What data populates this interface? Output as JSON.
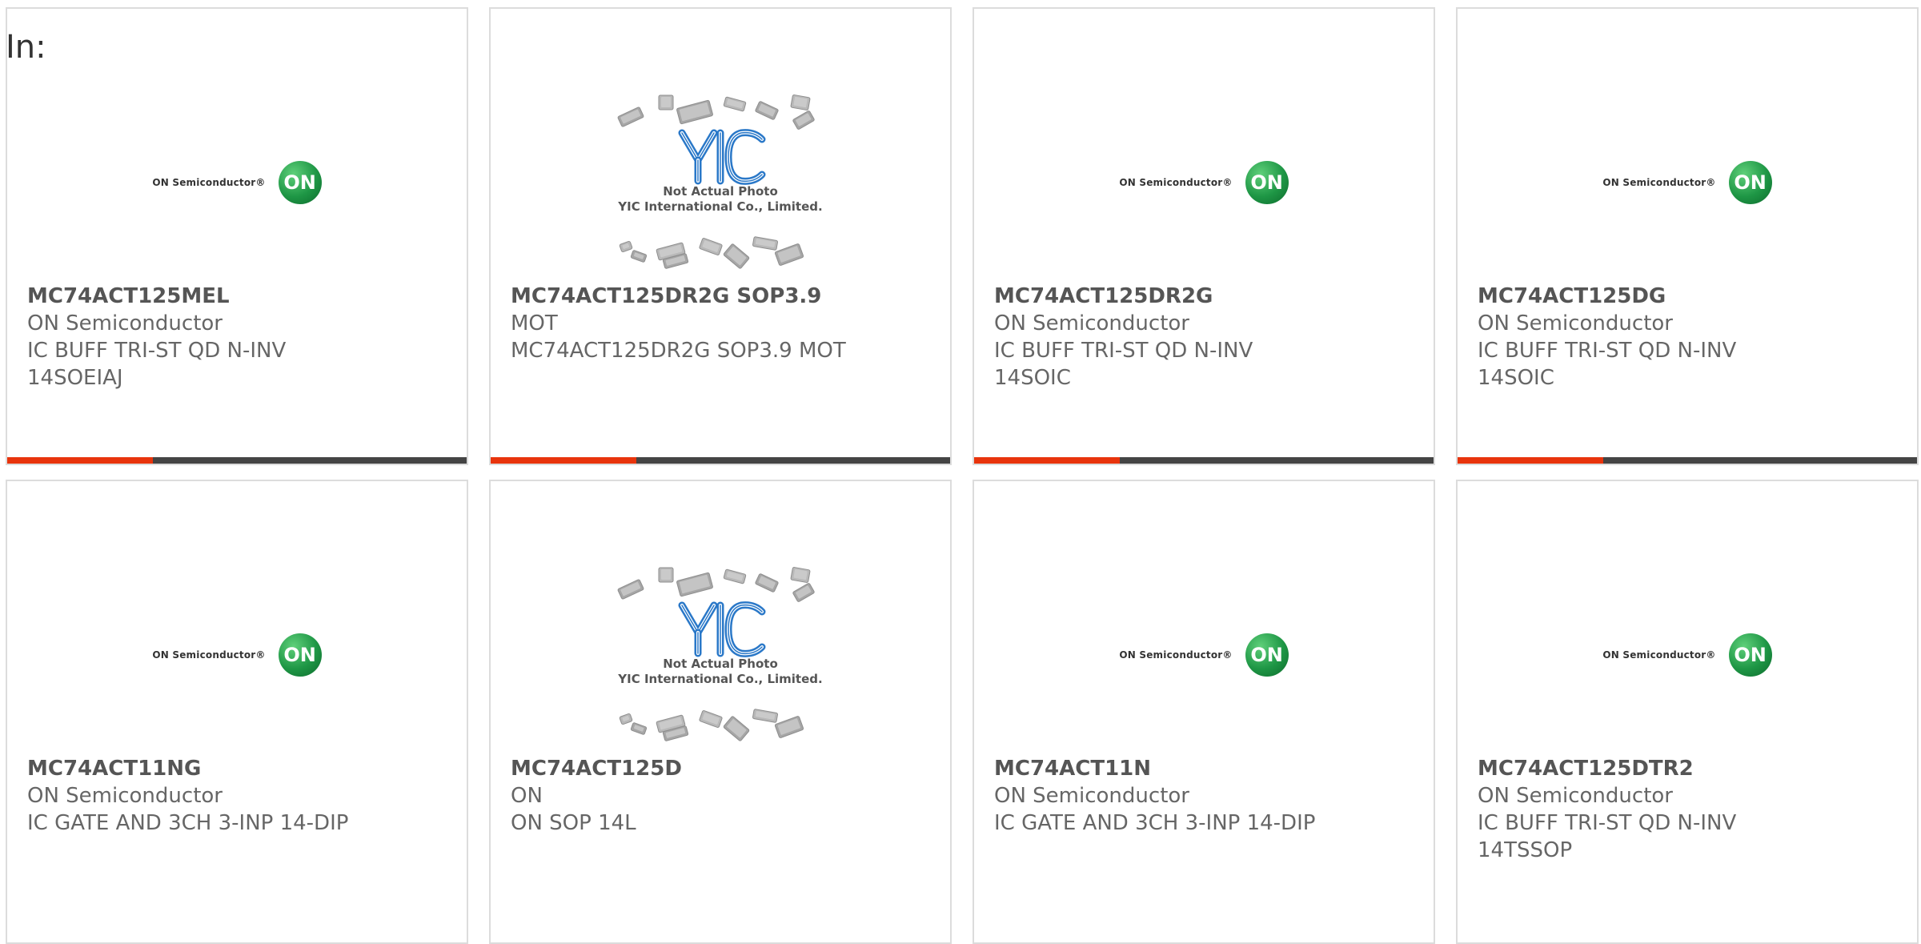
{
  "header": {
    "in_label": "In:"
  },
  "colors": {
    "accent": "#e8340c",
    "bar": "#444444",
    "on_green": "#1e9645",
    "yic_blue": "#2a78c8"
  },
  "placeholder": {
    "line1": "Not Actual Photo",
    "line2": "YIC International Co., Limited."
  },
  "on_logo": {
    "brand_text": "ON Semiconductor®",
    "circle_text": "ON"
  },
  "products": [
    {
      "part": "MC74ACT125MEL",
      "manufacturer": "ON Semiconductor",
      "description": "IC BUFF TRI-ST QD N-INV\n14SOEIAJ",
      "image": "on-semiconductor-logo"
    },
    {
      "part": "MC74ACT125DR2G SOP3.9",
      "manufacturer": "MOT",
      "description": "MC74ACT125DR2G SOP3.9 MOT",
      "image": "yic-placeholder"
    },
    {
      "part": "MC74ACT125DR2G",
      "manufacturer": "ON Semiconductor",
      "description": "IC BUFF TRI-ST QD N-INV\n14SOIC",
      "image": "on-semiconductor-logo"
    },
    {
      "part": "MC74ACT125DG",
      "manufacturer": "ON Semiconductor",
      "description": "IC BUFF TRI-ST QD N-INV\n14SOIC",
      "image": "on-semiconductor-logo"
    },
    {
      "part": "MC74ACT11NG",
      "manufacturer": "ON Semiconductor",
      "description": "IC GATE AND 3CH 3-INP 14-DIP",
      "image": "on-semiconductor-logo"
    },
    {
      "part": "MC74ACT125D",
      "manufacturer": "ON",
      "description": "ON SOP 14L",
      "image": "yic-placeholder"
    },
    {
      "part": "MC74ACT11N",
      "manufacturer": "ON Semiconductor",
      "description": "IC GATE AND 3CH 3-INP 14-DIP",
      "image": "on-semiconductor-logo"
    },
    {
      "part": "MC74ACT125DTR2",
      "manufacturer": "ON Semiconductor",
      "description": "IC BUFF TRI-ST QD N-INV\n14TSSOP",
      "image": "on-semiconductor-logo"
    }
  ]
}
